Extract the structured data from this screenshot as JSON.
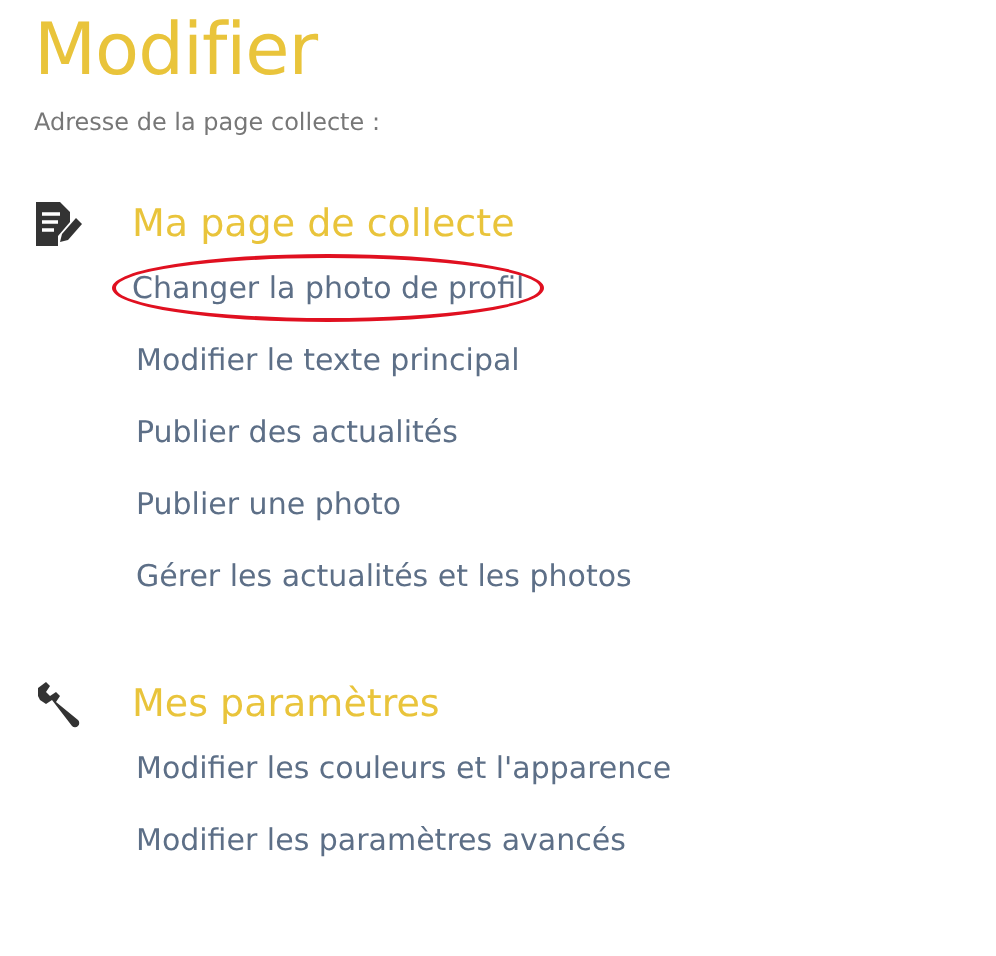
{
  "title": "Modifier",
  "subtitle": "Adresse de la page collecte :",
  "sections": [
    {
      "kind": "document",
      "heading": "Ma page de collecte",
      "links": [
        {
          "label": "Changer la photo de profil",
          "highlighted": true
        },
        {
          "label": "Modifier le texte principal",
          "highlighted": false
        },
        {
          "label": "Publier des actualités",
          "highlighted": false
        },
        {
          "label": "Publier une photo",
          "highlighted": false
        },
        {
          "label": "Gérer les actualités et les photos",
          "highlighted": false
        }
      ]
    },
    {
      "kind": "settings",
      "heading": "Mes paramètres",
      "links": [
        {
          "label": "Modifier les couleurs et l'apparence",
          "highlighted": false
        },
        {
          "label": "Modifier les paramètres avancés",
          "highlighted": false
        }
      ]
    }
  ]
}
